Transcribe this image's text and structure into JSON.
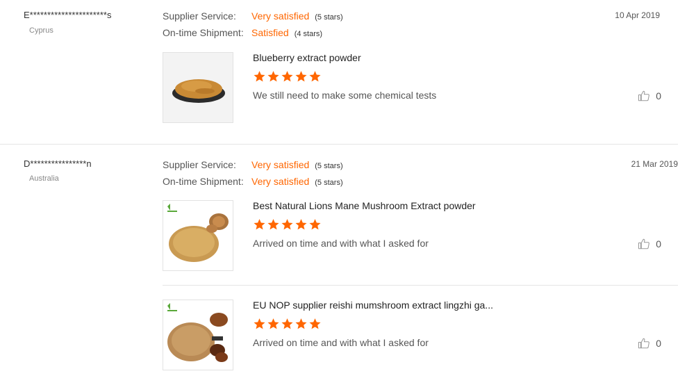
{
  "colors": {
    "accent": "#ff6600",
    "star": "#ff6600",
    "divider": "#e5e5e5"
  },
  "reviews": [
    {
      "buyer": "E**********************s",
      "country": "Cyprus",
      "date": "10 Apr 2019",
      "ratings": [
        {
          "label": "Supplier Service:",
          "value": "Very satisfied",
          "stars_text": "(5 stars)",
          "stars": 5
        },
        {
          "label": "On-time Shipment:",
          "value": "Satisfied",
          "stars_text": "(4 stars)",
          "stars": 4
        }
      ],
      "products": [
        {
          "title": "Blueberry extract powder",
          "stars": 5,
          "comment": "We still need to make some chemical tests",
          "likes": "0",
          "icon": "thumbs-up-icon"
        }
      ]
    },
    {
      "buyer": "D****************n",
      "country": "Australia",
      "date": "21 Mar 2019",
      "ratings": [
        {
          "label": "Supplier Service:",
          "value": "Very satisfied",
          "stars_text": "(5 stars)",
          "stars": 5
        },
        {
          "label": "On-time Shipment:",
          "value": "Very satisfied",
          "stars_text": "(5 stars)",
          "stars": 5
        }
      ],
      "products": [
        {
          "title": "Best Natural Lions Mane Mushroom Extract powder",
          "stars": 5,
          "comment": "Arrived on time and with what I asked for",
          "likes": "0",
          "icon": "thumbs-up-icon"
        },
        {
          "title": "EU NOP supplier reishi mumshroom extract lingzhi ga...",
          "stars": 5,
          "comment": "Arrived on time and with what I asked for",
          "likes": "0",
          "icon": "thumbs-up-icon"
        }
      ]
    }
  ]
}
